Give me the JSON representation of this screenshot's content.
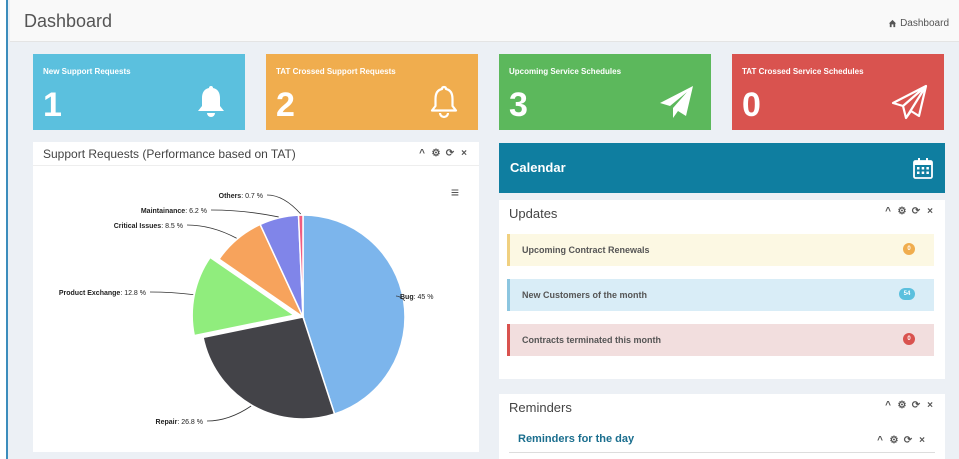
{
  "header": {
    "title": "Dashboard",
    "breadcrumb": "Dashboard"
  },
  "tiles": [
    {
      "label": "New Support Requests",
      "value": "1",
      "icon": "bell-icon",
      "color": "#5bc0de"
    },
    {
      "label": "TAT Crossed Support Requests",
      "value": "2",
      "icon": "bell-outline-icon",
      "color": "#f0ad4e"
    },
    {
      "label": "Upcoming Service Schedules",
      "value": "3",
      "icon": "paper-plane-icon",
      "color": "#5cb85c"
    },
    {
      "label": "TAT Crossed Service Schedules",
      "value": "0",
      "icon": "paper-plane-outline-icon",
      "color": "#d9534f"
    }
  ],
  "pie_panel": {
    "title": "Support Requests (Performance based on TAT)"
  },
  "chart_data": {
    "type": "pie",
    "slices": [
      {
        "label": "Bug",
        "value": 45,
        "display": "45 %",
        "color": "#7cb5ec"
      },
      {
        "label": "Repair",
        "value": 26.8,
        "display": "26.8 %",
        "color": "#434348"
      },
      {
        "label": "Product Exchange",
        "value": 12.8,
        "display": "12.8 %",
        "color": "#90ed7d"
      },
      {
        "label": "Critical Issues",
        "value": 8.5,
        "display": "8.5 %",
        "color": "#f7a35c"
      },
      {
        "label": "Maintainance",
        "value": 6.2,
        "display": "6.2 %",
        "color": "#8085e9"
      },
      {
        "label": "Others",
        "value": 0.7,
        "display": "0.7 %",
        "color": "#f15c80"
      }
    ],
    "sliced": "Product Exchange"
  },
  "calendar": {
    "title": "Calendar"
  },
  "updates": {
    "title": "Updates",
    "rows": [
      {
        "label": "Upcoming Contract Renewals",
        "count": "0"
      },
      {
        "label": "New Customers of the month",
        "count": "54"
      },
      {
        "label": "Contracts terminated this month",
        "count": "0"
      }
    ]
  },
  "reminders": {
    "title": "Reminders",
    "subtitle": "Reminders for the day"
  },
  "tools": {
    "collapse": "^",
    "settings": "⚙",
    "refresh": "⟳",
    "close": "×"
  }
}
